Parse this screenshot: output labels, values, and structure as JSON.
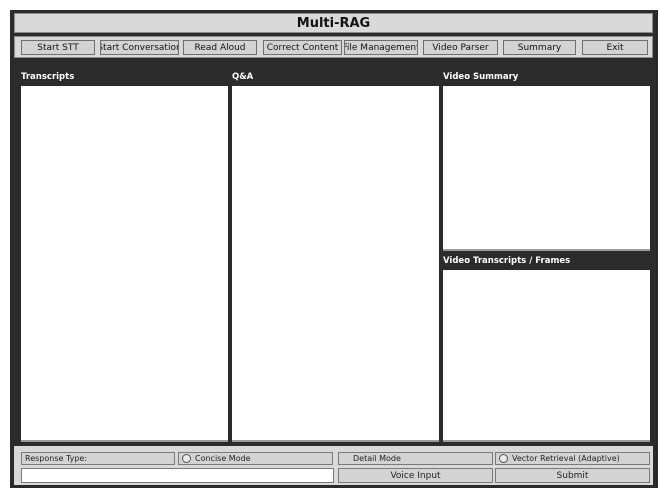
{
  "app": {
    "title": "Multi-RAG"
  },
  "toolbar": {
    "buttons": [
      "Start STT",
      "Start Conversation",
      "Read Aloud",
      "Correct Content",
      "File Management",
      "Video Parser",
      "Summary",
      "Exit"
    ]
  },
  "panels": {
    "transcripts_label": "Transcripts",
    "qa_label": "Q&A",
    "video_summary_label": "Video Summary",
    "video_frames_label": "Video Transcripts / Frames"
  },
  "footer": {
    "response_type_label": "Response Type:",
    "modes": [
      "Concise Mode",
      "Detail Mode",
      "Vector Retrieval (Adaptive)"
    ],
    "input_value": "",
    "voice_input_label": "Voice Input",
    "submit_label": "Submit"
  },
  "colors": {
    "background": "#2b2b2b",
    "chrome": "#d9d9d9",
    "button": "#d3d3d3"
  }
}
